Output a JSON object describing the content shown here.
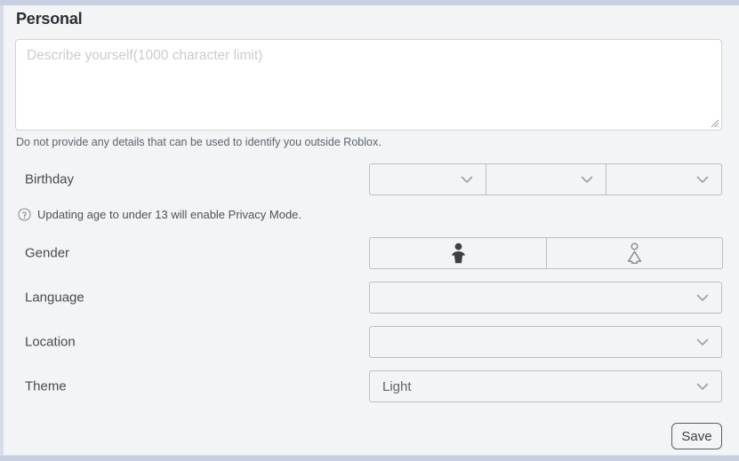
{
  "section": {
    "title": "Personal"
  },
  "description": {
    "name": "description-textarea",
    "value": "",
    "placeholder": "Describe yourself(1000 character limit)",
    "note": "Do not provide any details that can be used to identify you outside Roblox."
  },
  "birthday": {
    "label": "Birthday",
    "month": {
      "value": "",
      "placeholder": ""
    },
    "day": {
      "value": "",
      "placeholder": ""
    },
    "year": {
      "value": "",
      "placeholder": ""
    }
  },
  "privacy_hint": {
    "icon": "question-circle-icon",
    "text": "Updating age to under 13 will enable Privacy Mode."
  },
  "gender": {
    "label": "Gender",
    "options": [
      {
        "id": "male",
        "icon": "male-figure-icon",
        "selected": true,
        "color": "#3d4045"
      },
      {
        "id": "female",
        "icon": "female-figure-icon",
        "selected": false,
        "color": "#8c9196"
      }
    ]
  },
  "language": {
    "label": "Language",
    "value": ""
  },
  "location": {
    "label": "Location",
    "value": ""
  },
  "theme": {
    "label": "Theme",
    "value": "Light"
  },
  "actions": {
    "save_label": "Save"
  },
  "colors": {
    "page_background": "#f2f4f6",
    "outer_background": "#c7d0e0",
    "field_border": "#bcc0c4",
    "text_primary": "#2b2f35",
    "text_secondary": "#5b6570",
    "placeholder": "#c9ccd1"
  }
}
